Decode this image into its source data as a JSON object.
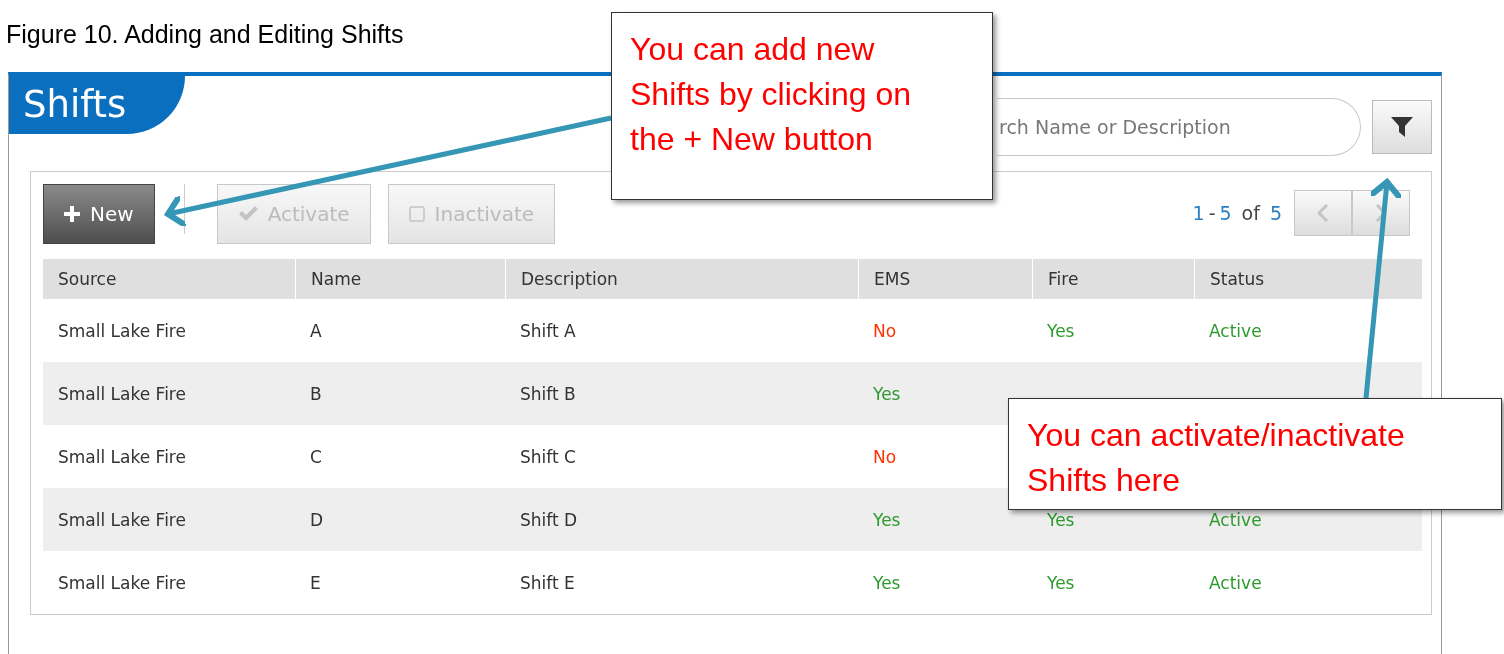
{
  "caption": "Figure 10. Adding and Editing Shifts",
  "screen": {
    "title": "Shifts",
    "search": {
      "placeholder": "rch Name or Description"
    },
    "toolbar": [
      {
        "kind": "add",
        "label": "New",
        "disabled": false
      },
      {
        "kind": "check",
        "label": "Activate",
        "disabled": true
      },
      {
        "kind": "box",
        "label": "Inactivate",
        "disabled": true
      }
    ],
    "pager": {
      "from": "1",
      "dash": "-",
      "to": "5",
      "of": "of",
      "total": "5"
    },
    "table": {
      "columns": [
        "Source",
        "Name",
        "Description",
        "EMS",
        "Fire",
        "Status"
      ],
      "rows": [
        {
          "source": "Small Lake Fire",
          "name": "A",
          "description": "Shift A",
          "ems": {
            "text": "No",
            "color": "#ff3300"
          },
          "fire": {
            "text": "Yes",
            "color": "#2e9a2e"
          },
          "status": {
            "text": "Active",
            "color": "#2e9a2e"
          }
        },
        {
          "source": "Small Lake Fire",
          "name": "B",
          "description": "Shift B",
          "ems": {
            "text": "Yes",
            "color": "#2e9a2e"
          }
        },
        {
          "source": "Small Lake Fire",
          "name": "C",
          "description": "Shift C",
          "ems": {
            "text": "No",
            "color": "#ff3300"
          }
        },
        {
          "source": "Small Lake Fire",
          "name": "D",
          "description": "Shift D",
          "ems": {
            "text": "Yes",
            "color": "#2e9a2e"
          },
          "fire": {
            "text": "Yes",
            "color": "#2e9a2e"
          },
          "status": {
            "text": "Active",
            "color": "#2e9a2e"
          }
        },
        {
          "source": "Small Lake Fire",
          "name": "E",
          "description": "Shift E",
          "ems": {
            "text": "Yes",
            "color": "#2e9a2e"
          },
          "fire": {
            "text": "Yes",
            "color": "#2e9a2e"
          },
          "status": {
            "text": "Active",
            "color": "#2e9a2e"
          }
        }
      ]
    }
  },
  "callouts": [
    {
      "text": "You can add new Shifts by clicking on the + New button"
    },
    {
      "text": "You can activate/inactivate Shifts here"
    }
  ]
}
